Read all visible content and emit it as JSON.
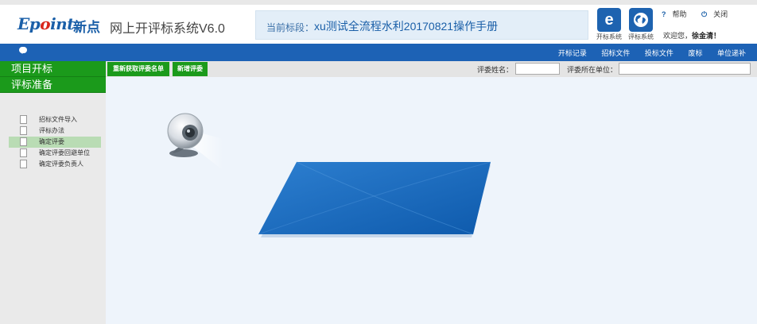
{
  "header": {
    "logo_text": "Epoint",
    "brand_cn": "新点",
    "system_title": "网上开评标系统V6.0",
    "section_label": "当前标段：",
    "section_value": "xu测试全流程水利20170821操作手册",
    "systems": [
      {
        "label": "开标系统",
        "icon": "e-icon"
      },
      {
        "label": "评标系统",
        "icon": "globe-icon"
      }
    ],
    "help_label": "帮助",
    "close_label": "关闭",
    "welcome_prefix": "欢迎您，",
    "user_name": "徐金清！"
  },
  "navbar": {
    "items": [
      "开标记录",
      "招标文件",
      "投标文件",
      "废标",
      "单位递补"
    ]
  },
  "sidebar": {
    "groups": [
      "项目开标",
      "评标准备"
    ],
    "items": [
      {
        "label": "招标文件导入"
      },
      {
        "label": "评标办法"
      },
      {
        "label": "确定评委"
      },
      {
        "label": "确定评委回避单位"
      },
      {
        "label": "确定评委负责人"
      }
    ],
    "active_index": 2
  },
  "toolbar": {
    "buttons": [
      "重新获取评委名单",
      "新增评委"
    ],
    "name_label": "评委姓名：",
    "name_value": "",
    "unit_label": "评委所在单位：",
    "unit_value": ""
  },
  "colors": {
    "accent_blue": "#1d62b5",
    "accent_green": "#1b9a1b"
  }
}
